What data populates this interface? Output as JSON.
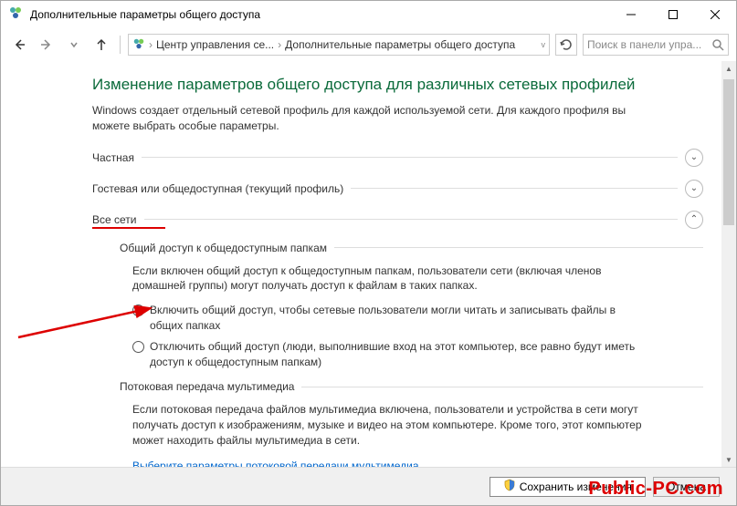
{
  "window": {
    "title": "Дополнительные параметры общего доступа"
  },
  "breadcrumb": {
    "item1": "Центр управления се...",
    "item2": "Дополнительные параметры общего доступа"
  },
  "search": {
    "placeholder": "Поиск в панели упра..."
  },
  "page": {
    "heading": "Изменение параметров общего доступа для различных сетевых профилей",
    "description": "Windows создает отдельный сетевой профиль для каждой используемой сети. Для каждого профиля вы можете выбрать особые параметры."
  },
  "sections": {
    "private": "Частная",
    "guest": "Гостевая или общедоступная (текущий профиль)",
    "all": "Все сети"
  },
  "group_public_folders": {
    "title": "Общий доступ к общедоступным папкам",
    "desc": "Если включен общий доступ к общедоступным папкам, пользователи сети (включая членов домашней группы) могут получать доступ к файлам в таких папках.",
    "radio1": "Включить общий доступ, чтобы сетевые пользователи могли читать и записывать файлы в общих папках",
    "radio2": "Отключить общий доступ (люди, выполнившие вход на этот компьютер, все равно будут иметь доступ к общедоступным папкам)"
  },
  "group_media": {
    "title": "Потоковая передача мультимедиа",
    "desc": "Если потоковая передача файлов мультимедиа включена, пользователи и устройства в сети могут получать доступ к изображениям, музыке и видео на этом компьютере. Кроме того, этот компьютер может находить файлы мультимедиа в сети.",
    "link": "Выберите параметры потоковой передачи мультимедиа..."
  },
  "buttons": {
    "save": "Сохранить изменения",
    "cancel": "Отмена"
  },
  "watermark": "Public-PC.com"
}
